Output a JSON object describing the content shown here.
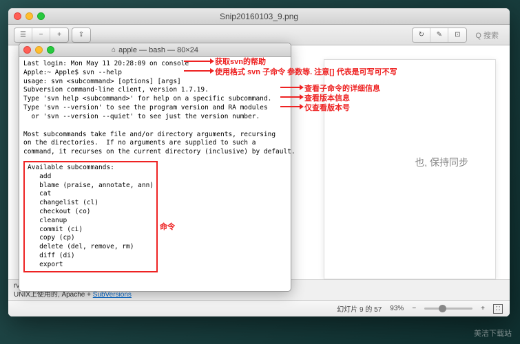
{
  "outer": {
    "title": "Snip20160103_9.png",
    "search_placeholder": "Q 搜索"
  },
  "terminal": {
    "title": "apple — bash — 80×24",
    "lines": {
      "l1": "Last login: Mon May 11 20:28:09 on console",
      "l2": "Apple:~ Apple$ svn --help",
      "l3": "usage: svn <subcommand> [options] [args]",
      "l4": "Subversion command-line client, version 1.7.19.",
      "l5": "Type 'svn help <subcommand>' for help on a specific subcommand.",
      "l6": "Type 'svn --version' to see the program version and RA modules",
      "l7": "  or 'svn --version --quiet' to see just the version number.",
      "l8": "",
      "l9": "Most subcommands take file and/or directory arguments, recursing",
      "l10": "on the directories.  If no arguments are supplied to such a",
      "l11": "command, it recurses on the current directory (inclusive) by default.",
      "sub_header": "Available subcommands:",
      "subs": [
        "   add",
        "   blame (praise, annotate, ann)",
        "   cat",
        "   changelist (cl)",
        "   checkout (co)",
        "   cleanup",
        "   commit (ci)",
        "   copy (cp)",
        "   delete (del, remove, rm)",
        "   diff (di)",
        "   export"
      ]
    }
  },
  "annotations": {
    "a1": "获取svn的帮助",
    "a2": "使用格式 svn 子命令 参数等. 注意[] 代表是可写可不写",
    "a3": "查看子命令的详细信息",
    "a4": "查看版本信息",
    "a5": "仅查看版本号",
    "a6": "命令"
  },
  "doc": {
    "visible_text": "也, 保持同步"
  },
  "footer": {
    "line1": "rver,运行在Windows平台,傻瓜式安装",
    "line2_a": "UNIX上使用的, Apache + ",
    "line2_link": "SubVersions"
  },
  "status": {
    "slide": "幻灯片 9 的 57",
    "zoom": "93%"
  },
  "watermark": "美洁下载站"
}
